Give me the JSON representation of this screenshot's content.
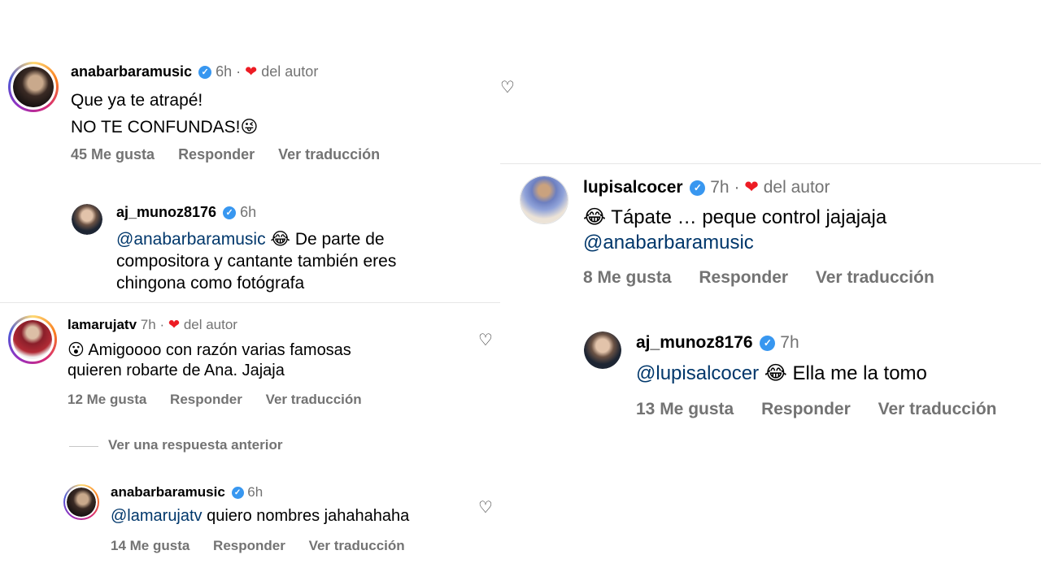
{
  "left": {
    "c1": {
      "username": "anabarbaramusic",
      "time": "6h",
      "author_label": "del autor",
      "line1": "Que ya te atrapé!",
      "line2": "NO TE CONFUNDAS!",
      "emoji": "😜",
      "likes": "45 Me gusta",
      "reply": "Responder",
      "translate": "Ver traducción"
    },
    "c1_reply": {
      "username": "aj_munoz8176",
      "time": "6h",
      "mention": "@anabarbaramusic",
      "emoji": "😂",
      "text_a": "De parte de",
      "text_b": "compositora y cantante también eres",
      "text_c": "chingona como fotógrafa"
    },
    "c2": {
      "username": "lamarujatv",
      "time": "7h",
      "author_label": "del autor",
      "emoji": "😮",
      "line1": "Amigoooo  con razón varias famosas",
      "line2": "quieren robarte de Ana.  Jajaja",
      "likes": "12 Me gusta",
      "reply": "Responder",
      "translate": "Ver traducción"
    },
    "view_previous": "Ver una respuesta anterior",
    "c2_reply": {
      "username": "anabarbaramusic",
      "time": "6h",
      "mention": "@lamarujatv",
      "text": " quiero nombres jahahahaha",
      "likes": "14 Me gusta",
      "reply": "Responder",
      "translate": "Ver traducción"
    }
  },
  "right": {
    "c1": {
      "username": "lupisalcocer",
      "time": "7h",
      "author_label": "del autor",
      "emoji": "😂",
      "line1": "Tápate … peque control jajajaja",
      "mention": "@anabarbaramusic",
      "likes": "8 Me gusta",
      "reply": "Responder",
      "translate": "Ver traducción"
    },
    "c1_reply": {
      "username": "aj_munoz8176",
      "time": "7h",
      "mention": "@lupisalcocer",
      "emoji": "😂",
      "text": "Ella me la tomo",
      "likes": "13 Me gusta",
      "reply": "Responder",
      "translate": "Ver traducción"
    }
  },
  "icons": {
    "heart": "heart-icon",
    "verified": "verified-badge-icon",
    "like": "like-heart-outline-icon"
  },
  "colors": {
    "heart": "#ed1c24",
    "verified": "#3897f0",
    "mention": "#00376b",
    "muted": "#737373"
  }
}
